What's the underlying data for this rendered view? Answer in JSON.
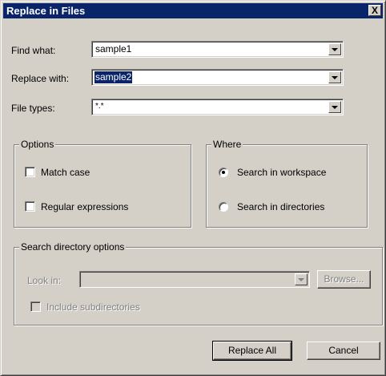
{
  "window": {
    "title": "Replace in Files",
    "close_glyph": "X"
  },
  "fields": {
    "find_label": "Find what:",
    "find_value": "sample1",
    "replace_label": "Replace with:",
    "replace_value": "sample2",
    "filetypes_label": "File types:",
    "filetypes_value": "*.*"
  },
  "options": {
    "title": "Options",
    "match_case": {
      "label": "Match case",
      "checked": false
    },
    "regex": {
      "label": "Regular expressions",
      "checked": false
    }
  },
  "where": {
    "title": "Where",
    "workspace": {
      "label": "Search in workspace",
      "selected": true
    },
    "directories": {
      "label": "Search in directories",
      "selected": false
    }
  },
  "search_dir": {
    "title": "Search directory options",
    "lookin_label": "Look in:",
    "lookin_value": "",
    "browse_label": "Browse...",
    "include_subdirs": {
      "label": "Include subdirectories",
      "checked": false
    },
    "enabled": false
  },
  "buttons": {
    "replace_all": "Replace All",
    "cancel": "Cancel"
  },
  "colors": {
    "titlebar": "#0a246a",
    "face": "#d4d0c8",
    "selection": "#0a246a",
    "disabled_text": "#808080"
  },
  "icons": {
    "close": "close-icon",
    "dropdown": "chevron-down-icon"
  }
}
